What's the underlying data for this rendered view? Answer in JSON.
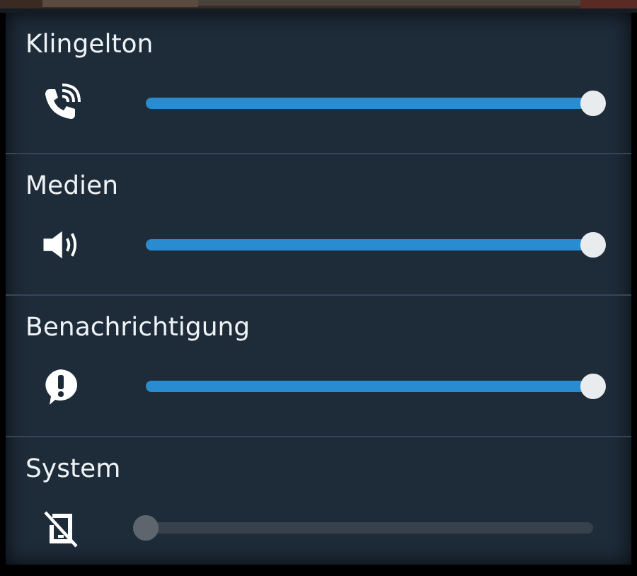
{
  "channels": [
    {
      "kind": "ring",
      "name": "Klingelton",
      "level": 1,
      "muted": false
    },
    {
      "kind": "media",
      "name": "Medien",
      "level": 1,
      "muted": false
    },
    {
      "kind": "notification",
      "name": "Benachrichtigung",
      "level": 1,
      "muted": false
    },
    {
      "kind": "system",
      "name": "System",
      "level": 0,
      "muted": true
    }
  ]
}
